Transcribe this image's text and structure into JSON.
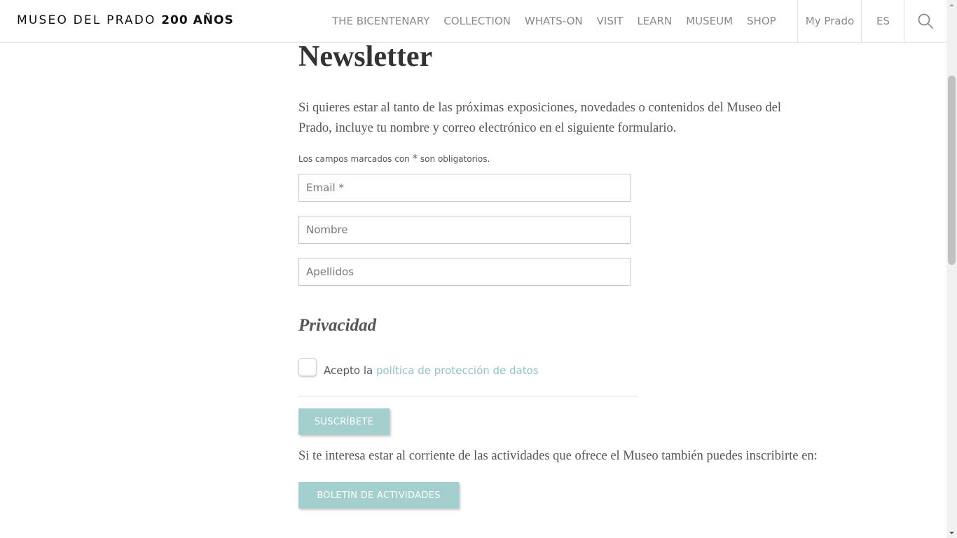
{
  "header": {
    "logo_main": "MUSEO DEL PRADO ",
    "logo_bold": "200 AÑOS",
    "nav": [
      "THE BICENTENARY",
      "COLLECTION",
      "WHATS-ON",
      "VISIT",
      "LEARN",
      "MUSEUM",
      "SHOP"
    ],
    "my_prado": "My Prado",
    "language": "ES",
    "search_icon": "search-icon"
  },
  "page": {
    "title": "Newsletter",
    "intro": "Si quieres estar al tanto de las próximas exposiciones, novedades o contenidos del Museo del Prado, incluye tu nombre y correo electrónico en el siguiente formulario.",
    "required_note_before": "Los campos marcados con ",
    "required_note_star": "*",
    "required_note_after": " son obligatorios."
  },
  "form": {
    "email": {
      "value": "",
      "placeholder": "Email *"
    },
    "nombre": {
      "value": "",
      "placeholder": "Nombre"
    },
    "apellidos": {
      "value": "",
      "placeholder": "Apellidos"
    },
    "privacy_title": "Privacidad",
    "accept_prefix": "Acepto la ",
    "accept_link": "política de protección de datos",
    "accept_checked": false,
    "submit_label": "SUSCRÍBETE"
  },
  "activities": {
    "text": "Si te interesa estar al corriente de las actividades que ofrece el Museo también puedes inscribirte en:",
    "button_label": "BOLETÍN DE ACTIVIDADES"
  },
  "colors": {
    "accent": "#a3cfcf",
    "link": "#8ec5c6",
    "nav_text": "#8a8a8a"
  }
}
